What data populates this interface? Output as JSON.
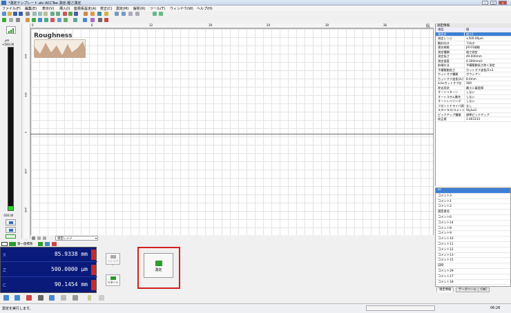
{
  "window": {
    "title": "*測定テンプレート.atc ACCTee 測定-粗さ測定",
    "min_label": "─",
    "max_label": "□",
    "close_label": "✕"
  },
  "menu": [
    {
      "label": "ファイル(F)"
    },
    {
      "label": "編集(E)"
    },
    {
      "label": "表示(V)"
    },
    {
      "label": "挿入(I)"
    },
    {
      "label": "座標系設定(A)"
    },
    {
      "label": "校正(C)"
    },
    {
      "label": "測定(M)"
    },
    {
      "label": "解析(R)"
    },
    {
      "label": "ツール(T)"
    },
    {
      "label": "ウィンドウ(W)"
    },
    {
      "label": "ヘルプ(H)"
    }
  ],
  "left_gauge": {
    "unit": "µm",
    "top_value": "+500.00",
    "bottom_value": "-500.00"
  },
  "ruler": {
    "ticks": [
      "0",
      "6",
      "12",
      "18",
      "24",
      "30",
      "36",
      "42"
    ],
    "unit": "mm",
    "v_ticks": [
      "400",
      "200",
      "0",
      "-200",
      "-400"
    ]
  },
  "graph": {
    "label": "Roughness"
  },
  "properties": {
    "header": "測定情報",
    "col_key": "項目",
    "col_val": "値",
    "rows": [
      {
        "key": "測定名",
        "value": "粗さ1",
        "selected": true
      },
      {
        "key": "測定レンジ",
        "value": "±500.00µm"
      },
      {
        "key": "触針向き",
        "value": "下向き"
      },
      {
        "key": "適合規格",
        "value": "JIS'01規格"
      },
      {
        "key": "測定種類",
        "value": "粗さ測定"
      },
      {
        "key": "測定長さ",
        "value": "40.000mm"
      },
      {
        "key": "測定速度",
        "value": "0.300mm/s"
      },
      {
        "key": "前端方法",
        "value": "予備駆動長さ除く測定"
      },
      {
        "key": "予備駆動長さ",
        "value": "カットオフ波長/2×2"
      },
      {
        "key": "カットオフ種類",
        "value": "ガウシアン"
      },
      {
        "key": "カットオフ波長(λc)",
        "value": "8.0mm"
      },
      {
        "key": "λcλsカットオフ比",
        "value": "300"
      },
      {
        "key": "除去形状",
        "value": "最小二乗直線"
      },
      {
        "key": "オートリターン",
        "value": "しない"
      },
      {
        "key": "オートコラム動作",
        "value": "しない"
      },
      {
        "key": "オートレベリング",
        "value": "しない"
      },
      {
        "key": "フロントドライバ調整",
        "value": "なし"
      },
      {
        "key": "スタイラス/コメント",
        "value": "Stylus1"
      },
      {
        "key": "ピックアップ種類",
        "value": "標準ピックアップ"
      },
      {
        "key": "校正値",
        "value": "1.003133"
      }
    ]
  },
  "comment_list": {
    "items": [
      {
        "label": "ID",
        "selected": true
      },
      {
        "label": "コメント3"
      },
      {
        "label": "コメント1"
      },
      {
        "label": "コメント2"
      },
      {
        "label": "測定者名"
      },
      {
        "label": "コメント6"
      },
      {
        "label": "コメント14"
      },
      {
        "label": "コメント8"
      },
      {
        "label": "コメント9"
      },
      {
        "label": "コメント10"
      },
      {
        "label": "コメント11"
      },
      {
        "label": "コメント12"
      },
      {
        "label": "コメント13"
      },
      {
        "label": "コメント15"
      },
      {
        "label": "日時"
      },
      {
        "label": "コメント29"
      },
      {
        "label": "コメント17"
      },
      {
        "label": "コメント18"
      }
    ]
  },
  "bottom_tabs": [
    {
      "label": "測定情報",
      "active": true
    },
    {
      "label": "データツール",
      "active": false
    },
    {
      "label": "CNC",
      "active": false
    }
  ],
  "measurement_range_dropdown": "測定レンジ",
  "coords": {
    "tab_label": "第一座標系",
    "rows": [
      {
        "axis": "X",
        "value": "85.9338 mm"
      },
      {
        "axis": "Z",
        "value": "500.0000 µm"
      },
      {
        "axis": "C",
        "value": "90.1454 mm"
      }
    ]
  },
  "actions": {
    "stop_label": "リトラクト",
    "return_label": "リターン",
    "measure_label": "測定"
  },
  "status": {
    "text": "測定を実行します。",
    "time": "06:26"
  },
  "colors": {
    "coord_bg": "#0a1a7a",
    "highlight": "#d21f1f",
    "selection": "#3d7fd6"
  }
}
